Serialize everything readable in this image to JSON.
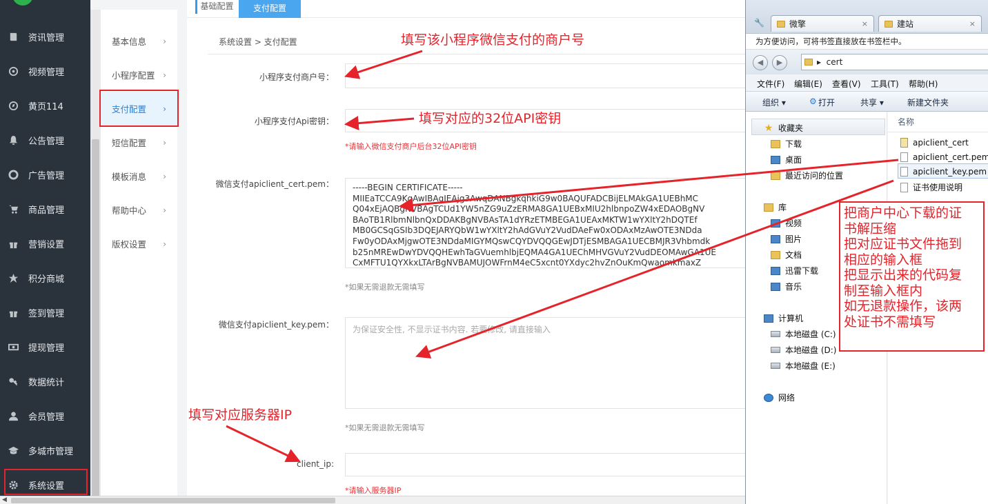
{
  "sidebar": {
    "items": [
      {
        "label": "资讯管理",
        "icon": "book-icon"
      },
      {
        "label": "视频管理",
        "icon": "video-icon"
      },
      {
        "label": "黄页114",
        "icon": "compass-icon"
      },
      {
        "label": "公告管理",
        "icon": "bell-icon"
      },
      {
        "label": "广告管理",
        "icon": "lifebuoy-icon"
      },
      {
        "label": "商品管理",
        "icon": "cart-icon"
      },
      {
        "label": "营销设置",
        "icon": "gift-icon"
      },
      {
        "label": "积分商城",
        "icon": "star-icon"
      },
      {
        "label": "签到管理",
        "icon": "gift-icon"
      },
      {
        "label": "提现管理",
        "icon": "money-icon"
      },
      {
        "label": "数据统计",
        "icon": "key-icon"
      },
      {
        "label": "会员管理",
        "icon": "user-icon"
      },
      {
        "label": "多城市管理",
        "icon": "graduation-cap-icon"
      },
      {
        "label": "系统设置",
        "icon": "gear-icon"
      }
    ],
    "active": "系统设置"
  },
  "subnav": {
    "items": [
      {
        "label": "基本信息"
      },
      {
        "label": "小程序配置"
      },
      {
        "label": "支付配置"
      },
      {
        "label": "短信配置"
      },
      {
        "label": "模板消息"
      },
      {
        "label": "帮助中心"
      },
      {
        "label": "版权设置"
      }
    ],
    "active": "支付配置",
    "chevron": "›"
  },
  "main": {
    "tab_a": "基础配置",
    "tab_b": "支付配置",
    "breadcrumb": "系统设置 > 支付配置",
    "fields": {
      "mch_id": {
        "label": "小程序支付商户号：",
        "value": ""
      },
      "api_key": {
        "label": "小程序支付Api密钥：",
        "value": "",
        "hint": "*请输入微信支付商户后台32位API密钥"
      },
      "cert": {
        "label": "微信支付apiclient_cert.pem：",
        "value": "-----BEGIN CERTIFICATE-----\nMIIEaTCCA9KgAwIBAgIEAjg3AwqDANBgkqhkiG9w0BAQUFADCBijELMAkGA1UEBhMC\nQ04xEjAQBgNVBAgTCUd1YW5nZG9uZzERMA8GA1UEBxMIU2hlbnpoZW4xEDAOBgNV\nBAoTB1RlbmNlbnQxDDAKBgNVBAsTA1dYRzETMBEGA1UEAxMKTW1wYXltY2hDQTEf\nMB0GCSqGSIb3DQEJARYQbW1wYXltY2hAdGVuY2VudDAeFw0xODAxMzAwOTE3NDda\nFw0yODAxMjgwOTE3NDdaMIGYMQswCQYDVQQGEwJDTjESMBAGA1UECBMJR3Vhbmdk\nb25nMREwDwYDVQQHEwhTaGVuemhlbjEQMA4GA1UEChMHVGVuY2VudDEOMAwGA1UE\nCxMFTU1QYXkxLTArBgNVBAMUJOWFrnM4eC5xcnt0YXdyc2hvZnOuKmQwaomkmaxZ",
        "hint": "*如果无需退款无需填写"
      },
      "key": {
        "label": "微信支付apiclient_key.pem：",
        "placeholder": "为保证安全性, 不显示证书内容. 若要修改, 请直接输入",
        "hint": "*如果无需退款无需填写"
      },
      "client_ip": {
        "label": "client_ip:",
        "value": "",
        "hint": "*请输入服务器IP"
      }
    }
  },
  "explorer": {
    "tabs": [
      {
        "label": "微擎",
        "close": "×"
      },
      {
        "label": "建站",
        "close": "×"
      }
    ],
    "bookmark_hint": "为方便访问，可将书签直接放在书签栏中。",
    "address": "cert",
    "address_sep": "▸",
    "nav_back": "◀",
    "nav_forward": "▶",
    "menu": [
      "文件(F)",
      "编辑(E)",
      "查看(V)",
      "工具(T)",
      "帮助(H)"
    ],
    "toolbar": [
      "组织 ▾",
      "打开",
      "共享 ▾",
      "新建文件夹"
    ],
    "tree": [
      {
        "label": "收藏夹",
        "icon": "star"
      },
      {
        "label": "下载",
        "icon": "folder"
      },
      {
        "label": "桌面",
        "icon": "blue"
      },
      {
        "label": "最近访问的位置",
        "icon": "folder"
      },
      {
        "label": "库",
        "icon": "folder"
      },
      {
        "label": "视频",
        "icon": "blue"
      },
      {
        "label": "图片",
        "icon": "blue"
      },
      {
        "label": "文档",
        "icon": "folder"
      },
      {
        "label": "迅雷下载",
        "icon": "blue"
      },
      {
        "label": "音乐",
        "icon": "blue"
      },
      {
        "label": "计算机",
        "icon": "blue"
      },
      {
        "label": "本地磁盘 (C:)",
        "icon": "drive"
      },
      {
        "label": "本地磁盘 (D:)",
        "icon": "drive"
      },
      {
        "label": "本地磁盘 (E:)",
        "icon": "drive"
      },
      {
        "label": "网络",
        "icon": "net"
      }
    ],
    "column_header": "名称",
    "files": [
      {
        "label": "apiclient_cert",
        "type": "cert"
      },
      {
        "label": "apiclient_cert.pem",
        "type": "file"
      },
      {
        "label": "apiclient_key.pem",
        "type": "file"
      },
      {
        "label": "证书使用说明",
        "type": "file"
      }
    ]
  },
  "annotations": {
    "mch_note": "填写该小程序微信支付的商户号",
    "key_note": "填写对应的32位API密钥",
    "ip_note": "填写对应服务器IP",
    "cert_steps": [
      "把商户中心下载的证",
      "书解压缩",
      "把对应证书文件拖到",
      "相应的输入框",
      "把显示出来的代码复",
      "制至输入框内",
      "如无退款操作，该两",
      "处证书不需填写"
    ],
    "color": "#e4232a"
  },
  "colors": {
    "sidebar_bg": "#2a323c",
    "accent": "#2f80d1",
    "tab_active": "#4aa6ef",
    "error": "#e2353a"
  }
}
